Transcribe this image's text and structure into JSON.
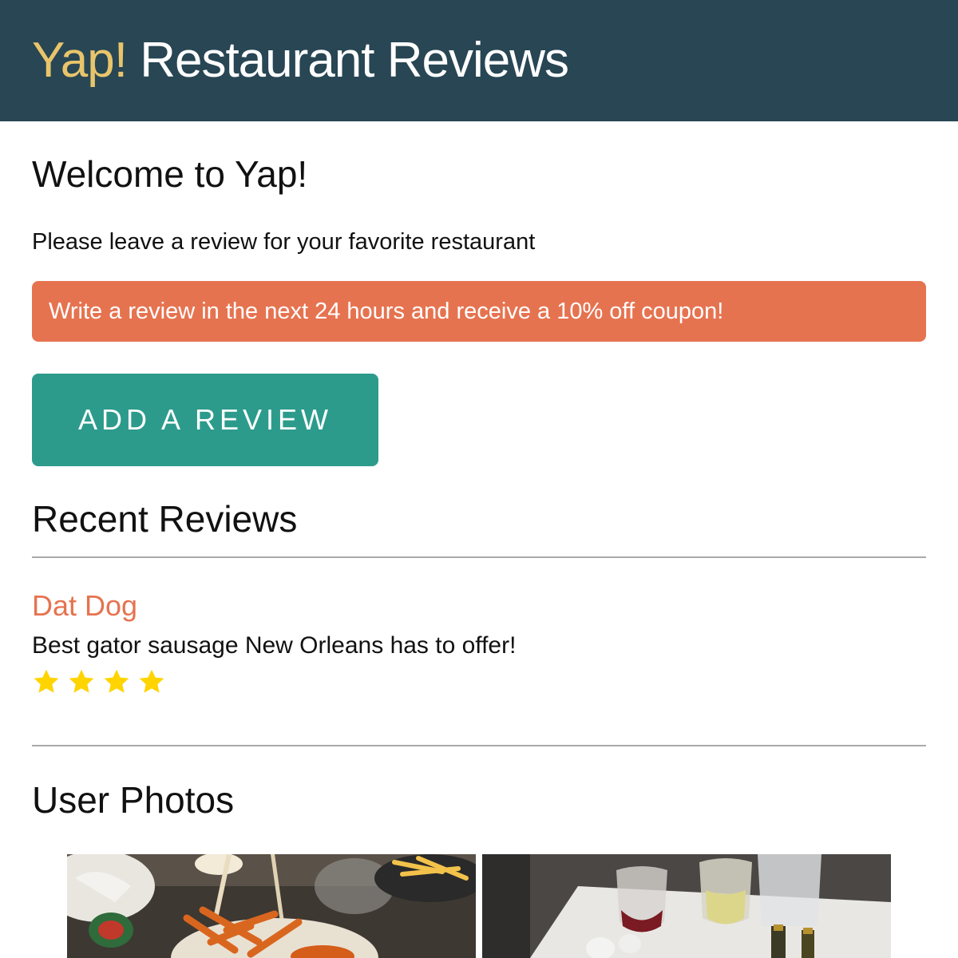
{
  "header": {
    "brand_accent": "Yap!",
    "brand_rest": "Restaurant Reviews"
  },
  "welcome": {
    "title": "Welcome to Yap!",
    "subtitle": "Please leave a review for your favorite restaurant"
  },
  "promo": {
    "text": "Write a review in the next 24 hours and receive a 10% off coupon!"
  },
  "actions": {
    "add_review_label": "ADD A REVIEW"
  },
  "recent_reviews": {
    "title": "Recent Reviews",
    "items": [
      {
        "name": "Dat Dog",
        "text": "Best gator sausage New Orleans has to offer!",
        "rating": 4,
        "icon": "star-icon"
      }
    ]
  },
  "user_photos": {
    "title": "User Photos",
    "photos": [
      {
        "icon": "food-photo-fries"
      },
      {
        "icon": "food-photo-wine-table"
      }
    ]
  },
  "colors": {
    "header_bg": "#284654",
    "brand_accent": "#e8c56b",
    "promo_bg": "#e67350",
    "button_bg": "#2c9b8c",
    "review_name": "#e67350",
    "star": "#ffd400"
  }
}
